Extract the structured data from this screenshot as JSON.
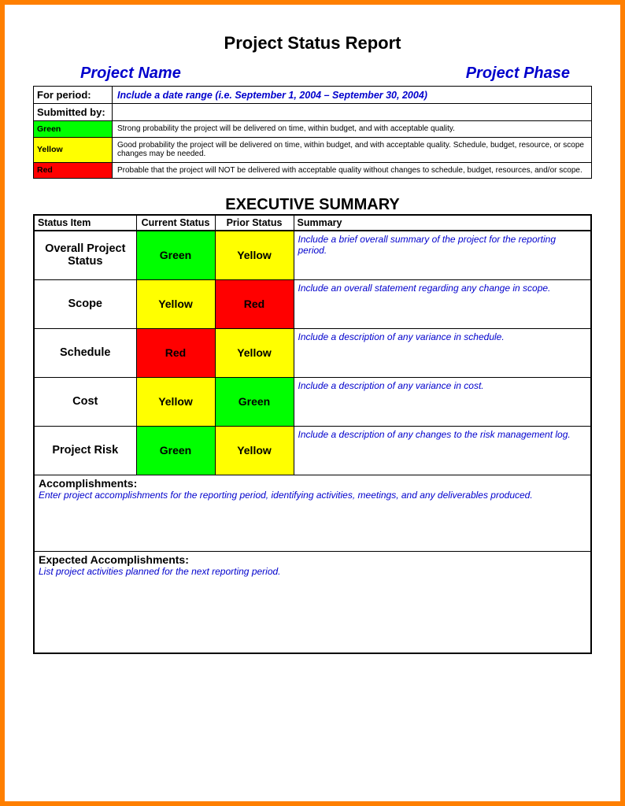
{
  "page_title": "Project Status Report",
  "header": {
    "name_label": "Project Name",
    "phase_label": "Project Phase"
  },
  "top_table": {
    "for_period_label": "For period:",
    "for_period_value": "Include a date range (i.e. September 1, 2004 – September 30, 2004)",
    "submitted_by_label": "Submitted by:",
    "legend": [
      {
        "name": "Green",
        "class": "bg-green",
        "desc": "Strong probability the project will be delivered on time, within budget, and with acceptable quality."
      },
      {
        "name": "Yellow",
        "class": "bg-yellow",
        "desc": "Good probability the project will be delivered on time, within budget, and with acceptable quality. Schedule, budget, resource, or scope changes may be needed."
      },
      {
        "name": "Red",
        "class": "bg-red",
        "desc": "Probable that the project will NOT be delivered with acceptable quality without changes to schedule, budget, resources, and/or scope."
      }
    ]
  },
  "exec": {
    "title": "EXECUTIVE SUMMARY",
    "headers": {
      "status_item": "Status Item",
      "current": "Current Status",
      "prior": "Prior Status",
      "summary": "Summary"
    },
    "rows": [
      {
        "label": "Overall Project Status",
        "current": "Green",
        "current_class": "bg-green",
        "prior": "Yellow",
        "prior_class": "bg-yellow",
        "summary": "Include a brief overall summary of the project for the reporting period."
      },
      {
        "label": "Scope",
        "current": "Yellow",
        "current_class": "bg-yellow",
        "prior": "Red",
        "prior_class": "bg-red",
        "summary": "Include an overall statement regarding any change in scope."
      },
      {
        "label": "Schedule",
        "current": "Red",
        "current_class": "bg-red",
        "prior": "Yellow",
        "prior_class": "bg-yellow",
        "summary": "Include a description of any variance in schedule."
      },
      {
        "label": "Cost",
        "current": "Yellow",
        "current_class": "bg-yellow",
        "prior": "Green",
        "prior_class": "bg-green",
        "summary": "Include a description of any variance in cost."
      },
      {
        "label": "Project Risk",
        "current": "Green",
        "current_class": "bg-green",
        "prior": "Yellow",
        "prior_class": "bg-yellow",
        "summary": "Include a description of any changes to the risk management log."
      }
    ],
    "accomplishments": {
      "label": "Accomplishments:",
      "text": "Enter project accomplishments for the reporting period, identifying activities, meetings, and any deliverables produced."
    },
    "expected": {
      "label": "Expected Accomplishments:",
      "text": "List project activities planned for the next reporting period."
    }
  }
}
